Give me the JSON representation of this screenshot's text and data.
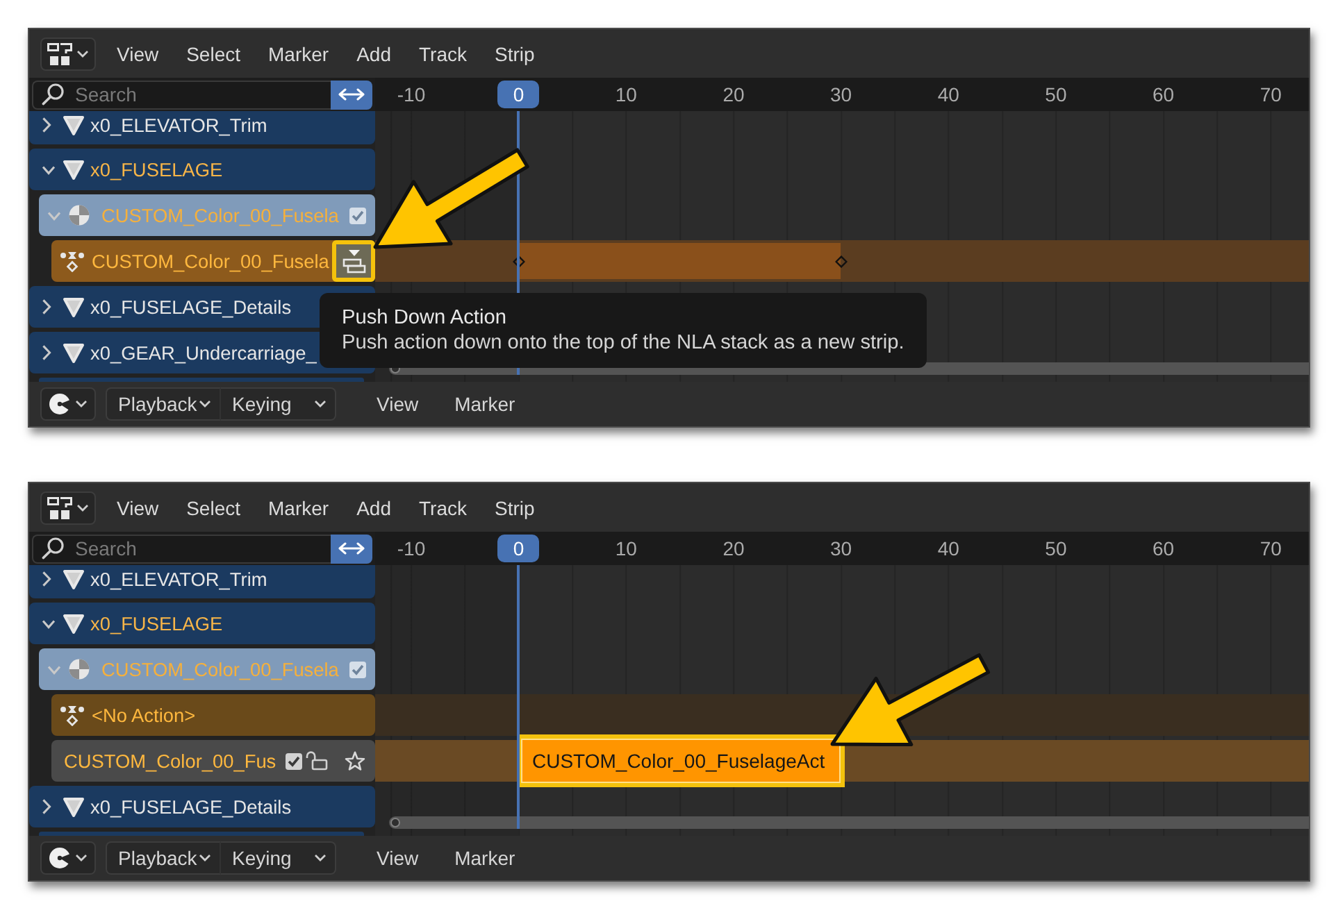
{
  "panels": [
    {
      "header": {
        "menus": [
          "View",
          "Select",
          "Marker",
          "Add",
          "Track",
          "Strip"
        ]
      },
      "search": {
        "placeholder": "Search"
      },
      "ruler": {
        "ticks": [
          {
            "label": "-10",
            "current": false
          },
          {
            "label": "0",
            "current": true
          },
          {
            "label": "10",
            "current": false
          },
          {
            "label": "20",
            "current": false
          },
          {
            "label": "30",
            "current": false
          },
          {
            "label": "40",
            "current": false
          },
          {
            "label": "50",
            "current": false
          },
          {
            "label": "60",
            "current": false
          },
          {
            "label": "70",
            "current": false
          }
        ]
      },
      "channels": [
        {
          "kind": "object",
          "label": "x0_ELEVATOR_Trim",
          "expanded": false,
          "selected": false
        },
        {
          "kind": "object",
          "label": "x0_FUSELAGE",
          "expanded": true,
          "selected": true
        },
        {
          "kind": "material",
          "label": "CUSTOM_Color_00_Fusela",
          "expanded": true,
          "selected": true,
          "checked": true
        },
        {
          "kind": "action",
          "label": "CUSTOM_Color_00_Fusela",
          "selected": true,
          "assigned": true,
          "push_down": {
            "highlighted": true
          }
        },
        {
          "kind": "object",
          "label": "x0_FUSELAGE_Details",
          "expanded": false,
          "selected": false
        },
        {
          "kind": "object",
          "label": "x0_GEAR_Undercarriage_",
          "expanded": false,
          "selected": false
        }
      ],
      "tooltip": {
        "title": "Push Down Action",
        "description": "Push action down onto the top of the NLA stack as a new strip."
      },
      "footer": {
        "dropdowns": [
          "Playback",
          "Keying"
        ],
        "menus": [
          "View",
          "Marker"
        ]
      }
    },
    {
      "header": {
        "menus": [
          "View",
          "Select",
          "Marker",
          "Add",
          "Track",
          "Strip"
        ]
      },
      "search": {
        "placeholder": "Search"
      },
      "ruler": {
        "ticks": [
          {
            "label": "-10",
            "current": false
          },
          {
            "label": "0",
            "current": true
          },
          {
            "label": "10",
            "current": false
          },
          {
            "label": "20",
            "current": false
          },
          {
            "label": "30",
            "current": false
          },
          {
            "label": "40",
            "current": false
          },
          {
            "label": "50",
            "current": false
          },
          {
            "label": "60",
            "current": false
          },
          {
            "label": "70",
            "current": false
          }
        ]
      },
      "channels": [
        {
          "kind": "object",
          "label": "x0_ELEVATOR_Trim",
          "expanded": false,
          "selected": false
        },
        {
          "kind": "object",
          "label": "x0_FUSELAGE",
          "expanded": true,
          "selected": true
        },
        {
          "kind": "material",
          "label": "CUSTOM_Color_00_Fusela",
          "expanded": true,
          "selected": true,
          "checked": true
        },
        {
          "kind": "action",
          "label": "<No Action>",
          "selected": true,
          "assigned": false
        },
        {
          "kind": "track",
          "label": "CUSTOM_Color_00_Fus",
          "selected": true,
          "checked": true,
          "locked": false,
          "solo": false,
          "strip": {
            "label": "CUSTOM_Color_00_FuselageAct",
            "highlighted": true
          }
        },
        {
          "kind": "object",
          "label": "x0_FUSELAGE_Details",
          "expanded": false,
          "selected": false
        }
      ],
      "footer": {
        "dropdowns": [
          "Playback",
          "Keying"
        ],
        "menus": [
          "View",
          "Marker"
        ]
      }
    }
  ]
}
